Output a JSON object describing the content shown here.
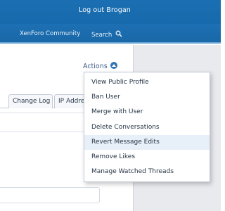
{
  "header": {
    "logout_label": "Log out Brogan"
  },
  "nav": {
    "community_label": "XenForo Community",
    "search_label": "Search"
  },
  "actions": {
    "label": "Actions"
  },
  "tabs": [
    {
      "label": "Change Log"
    },
    {
      "label": "IP Addre"
    }
  ],
  "menu": {
    "items": [
      {
        "label": "View Public Profile"
      },
      {
        "label": "Ban User"
      },
      {
        "label": "Merge with User"
      },
      {
        "label": "Delete Conversations"
      },
      {
        "label": "Revert Message Edits"
      },
      {
        "label": "Remove Likes"
      },
      {
        "label": "Manage Watched Threads"
      }
    ],
    "hovered_item": "Revert Message Edits"
  },
  "colors": {
    "header": "#1a6fb2",
    "menu_hover": "#e7eff8",
    "gutter": "#e8eaee"
  }
}
